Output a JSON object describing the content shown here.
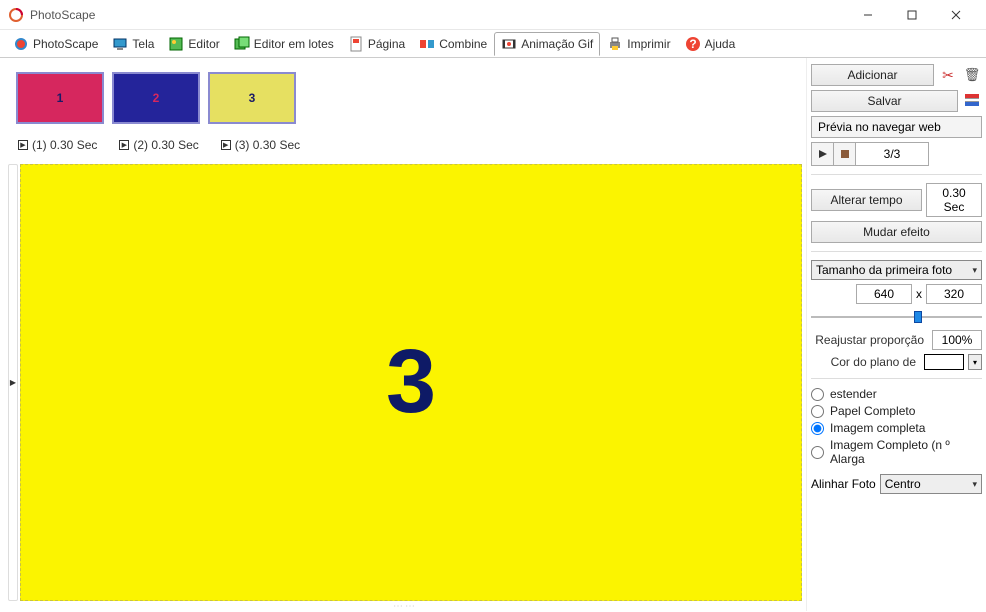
{
  "window": {
    "title": "PhotoScape"
  },
  "tabs": [
    {
      "label": "PhotoScape"
    },
    {
      "label": "Tela"
    },
    {
      "label": "Editor"
    },
    {
      "label": "Editor em lotes"
    },
    {
      "label": "Página"
    },
    {
      "label": "Combine"
    },
    {
      "label": "Animação Gif"
    },
    {
      "label": "Imprimir"
    },
    {
      "label": "Ajuda"
    }
  ],
  "thumbs": [
    {
      "label": "1"
    },
    {
      "label": "2"
    },
    {
      "label": "3"
    }
  ],
  "frame_info": [
    {
      "text": "(1) 0.30 Sec"
    },
    {
      "text": "(2) 0.30 Sec"
    },
    {
      "text": "(3) 0.30 Sec"
    }
  ],
  "preview": {
    "big_number": "3"
  },
  "panel": {
    "add": "Adicionar",
    "save": "Salvar",
    "preview_web": "Prévia no navegar web",
    "counter": "3/3",
    "change_time": "Alterar tempo",
    "time_value": "0.30 Sec",
    "change_effect": "Mudar efeito",
    "size_mode": "Tamanho da primeira foto",
    "width": "640",
    "height": "320",
    "x_label": "x",
    "readjust": "Reajustar proporção",
    "readjust_value": "100%",
    "bg_color_label": "Cor do plano de",
    "radios": {
      "extend": "estender",
      "full_paper": "Papel Completo",
      "full_image": "Imagem completa",
      "full_image_no_enlarge": "Imagem Completo (n º Alarga"
    },
    "align_label": "Alinhar Foto",
    "align_value": "Centro"
  }
}
